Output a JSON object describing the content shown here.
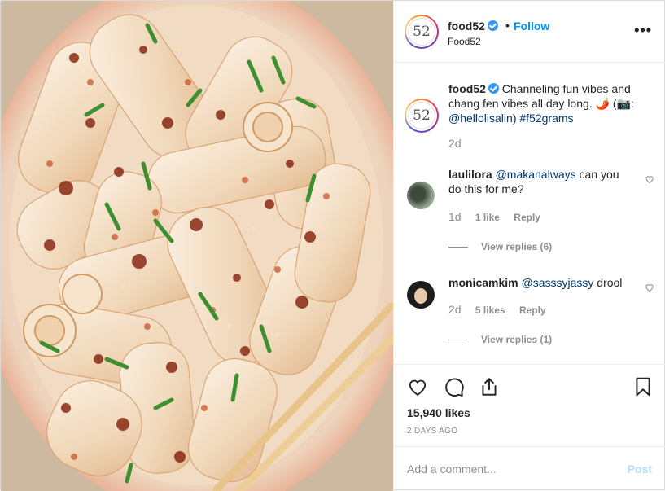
{
  "post": {
    "username": "food52",
    "follow_label": "Follow",
    "separator": "•",
    "subname": "Food52",
    "avatar_text": "52",
    "more_label": "•••"
  },
  "caption": {
    "username": "food52",
    "text_part1": "Channeling fun vibes and chang fen vibes all day long. 🌶️ (📷: ",
    "mention": "@hellolisalin",
    "text_part2": ") ",
    "hashtag": "#f52grams",
    "time": "2d"
  },
  "comments": [
    {
      "username": "laulilora",
      "mention": "@makanalways",
      "text": " can you do this for me?",
      "time": "1d",
      "likes": "1 like",
      "reply_label": "Reply",
      "view_replies": "View replies (6)"
    },
    {
      "username": "monicamkim",
      "mention": "@sasssyjassy",
      "text": " drool",
      "time": "2d",
      "likes": "5 likes",
      "reply_label": "Reply",
      "view_replies": "View replies (1)"
    }
  ],
  "actions": {
    "like_count": "15,940 likes",
    "posted_ago": "2 DAYS AGO",
    "icons": [
      "heart-icon",
      "comment-icon",
      "share-icon",
      "bookmark-icon"
    ]
  },
  "add_comment": {
    "placeholder": "Add a comment...",
    "post_label": "Post"
  },
  "colors": {
    "link": "#00376b",
    "follow": "#0095f6",
    "post_disabled": "#b2dffc",
    "muted": "#8e8e8e"
  }
}
